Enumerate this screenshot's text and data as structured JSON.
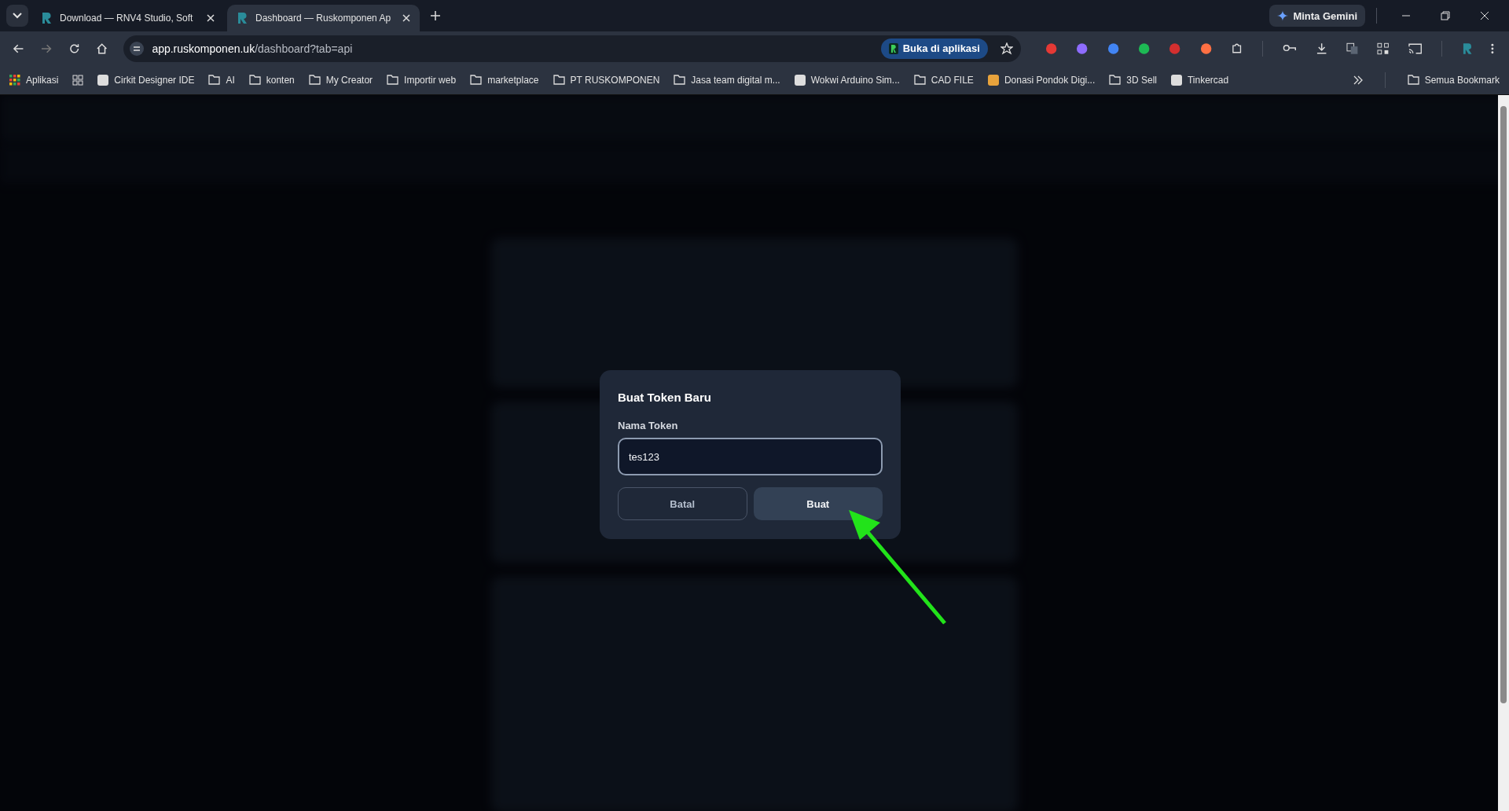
{
  "tabs": [
    {
      "title": "Download — RNV4 Studio, Soft",
      "selected": false
    },
    {
      "title": "Dashboard — Ruskomponen Ap",
      "selected": true
    }
  ],
  "gemini_button": "Minta Gemini",
  "address": {
    "domain": "app.ruskomponen.uk",
    "path": "/dashboard?tab=api"
  },
  "open_in_app": "Buka di aplikasi",
  "bookmarks": [
    {
      "label": "Aplikasi",
      "kind": "apps"
    },
    {
      "label": "Cirkit Designer IDE",
      "kind": "site"
    },
    {
      "label": "AI",
      "kind": "folder"
    },
    {
      "label": "konten",
      "kind": "folder"
    },
    {
      "label": "My Creator",
      "kind": "folder"
    },
    {
      "label": "Importir web",
      "kind": "folder"
    },
    {
      "label": "marketplace",
      "kind": "folder"
    },
    {
      "label": "PT RUSKOMPONEN",
      "kind": "folder"
    },
    {
      "label": "Jasa team digital m...",
      "kind": "folder"
    },
    {
      "label": "Wokwi Arduino Sim...",
      "kind": "site"
    },
    {
      "label": "CAD FILE",
      "kind": "folder"
    },
    {
      "label": "Donasi Pondok Digi...",
      "kind": "site"
    },
    {
      "label": "3D Sell",
      "kind": "folder"
    },
    {
      "label": "Tinkercad",
      "kind": "site"
    }
  ],
  "all_bookmarks": "Semua Bookmark",
  "dialog": {
    "title": "Buat Token Baru",
    "field_label": "Nama Token",
    "field_value": "tes123",
    "buttons": [
      {
        "label": "Batal",
        "kind": "secondary"
      },
      {
        "label": "Buat",
        "kind": "primary"
      }
    ]
  }
}
